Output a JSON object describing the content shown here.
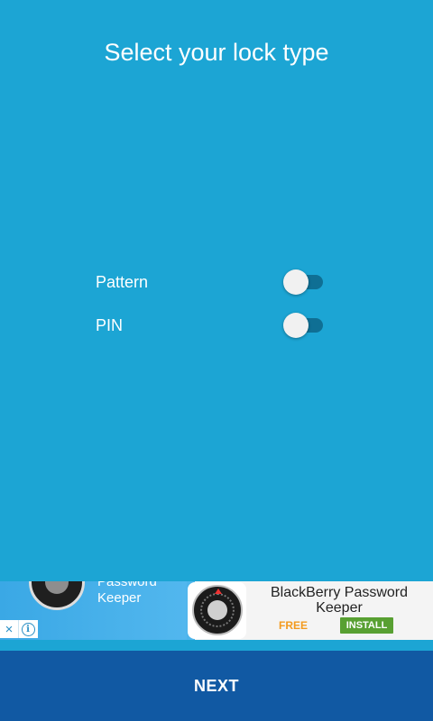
{
  "header": {
    "title": "Select your lock type"
  },
  "options": [
    {
      "label": "Pattern",
      "enabled": false
    },
    {
      "label": "PIN",
      "enabled": false
    }
  ],
  "ad": {
    "left_text": "Password Keeper",
    "title": "BlackBerry Password Keeper",
    "price": "FREE",
    "install_label": "INSTALL",
    "close_icon": "×",
    "info_icon": "i"
  },
  "footer": {
    "next_label": "NEXT"
  },
  "colors": {
    "background": "#1ca5d4",
    "next_bar": "#1159a3",
    "install_button": "#58a032",
    "free_text": "#f39a1e"
  }
}
